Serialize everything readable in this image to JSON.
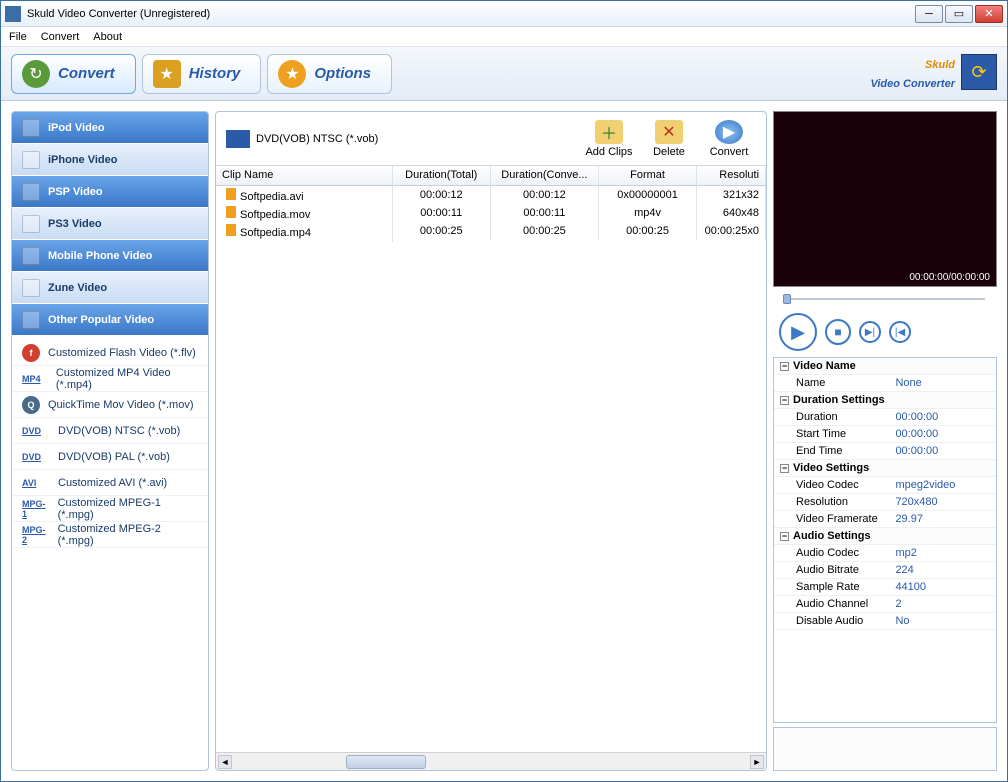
{
  "window": {
    "title": "Skuld Video Converter (Unregistered)"
  },
  "menu": {
    "file": "File",
    "convert": "Convert",
    "about": "About"
  },
  "tabs": {
    "convert": "Convert",
    "history": "History",
    "options": "Options"
  },
  "brand": {
    "line1": "Skuld",
    "line2": "Video Converter"
  },
  "sidebar": {
    "categories": [
      {
        "label": "iPod Video"
      },
      {
        "label": "iPhone Video"
      },
      {
        "label": "PSP Video"
      },
      {
        "label": "PS3 Video"
      },
      {
        "label": "Mobile Phone Video"
      },
      {
        "label": "Zune Video"
      },
      {
        "label": "Other Popular Video"
      }
    ],
    "formats": [
      {
        "badge": "f",
        "label": "Customized Flash Video (*.flv)"
      },
      {
        "badge": "MP4",
        "label": "Customized MP4 Video (*.mp4)"
      },
      {
        "badge": "Q",
        "label": "QuickTime Mov Video (*.mov)"
      },
      {
        "badge": "DVD",
        "label": "DVD(VOB) NTSC (*.vob)"
      },
      {
        "badge": "DVD",
        "label": "DVD(VOB) PAL (*.vob)"
      },
      {
        "badge": "AVI",
        "label": "Customized AVI (*.avi)"
      },
      {
        "badge": "MPG-1",
        "label": "Customized MPEG-1 (*.mpg)"
      },
      {
        "badge": "MPG-2",
        "label": "Customized MPEG-2 (*.mpg)"
      }
    ]
  },
  "toolbar": {
    "profile": "DVD(VOB) NTSC (*.vob)",
    "add_clips": "Add Clips",
    "delete": "Delete",
    "convert": "Convert"
  },
  "grid": {
    "headers": {
      "name": "Clip Name",
      "dur_total": "Duration(Total)",
      "dur_conv": "Duration(Conve...",
      "format": "Format",
      "resolution": "Resoluti"
    },
    "rows": [
      {
        "name": "Softpedia.avi",
        "dt": "00:00:12",
        "dc": "00:00:12",
        "fmt": "0x00000001",
        "res": "321x32"
      },
      {
        "name": "Softpedia.mov",
        "dt": "00:00:11",
        "dc": "00:00:11",
        "fmt": "mp4v",
        "res": "640x48"
      },
      {
        "name": "Softpedia.mp4",
        "dt": "00:00:25",
        "dc": "00:00:25",
        "fmt": "00:00:25",
        "res": "00:00:25x0"
      }
    ]
  },
  "preview": {
    "time": "00:00:00/00:00:00"
  },
  "props": {
    "groups": [
      {
        "title": "Video Name",
        "rows": [
          {
            "k": "Name",
            "v": "None"
          }
        ]
      },
      {
        "title": "Duration Settings",
        "rows": [
          {
            "k": "Duration",
            "v": "00:00:00"
          },
          {
            "k": "Start Time",
            "v": "00:00:00"
          },
          {
            "k": "End Time",
            "v": "00:00:00"
          }
        ]
      },
      {
        "title": "Video Settings",
        "rows": [
          {
            "k": "Video Codec",
            "v": "mpeg2video"
          },
          {
            "k": "Resolution",
            "v": "720x480"
          },
          {
            "k": "Video Framerate",
            "v": "29.97"
          }
        ]
      },
      {
        "title": "Audio Settings",
        "rows": [
          {
            "k": "Audio Codec",
            "v": "mp2"
          },
          {
            "k": "Audio Bitrate",
            "v": "224"
          },
          {
            "k": "Sample Rate",
            "v": "44100"
          },
          {
            "k": "Audio Channel",
            "v": "2"
          },
          {
            "k": "Disable Audio",
            "v": "No"
          }
        ]
      }
    ]
  }
}
